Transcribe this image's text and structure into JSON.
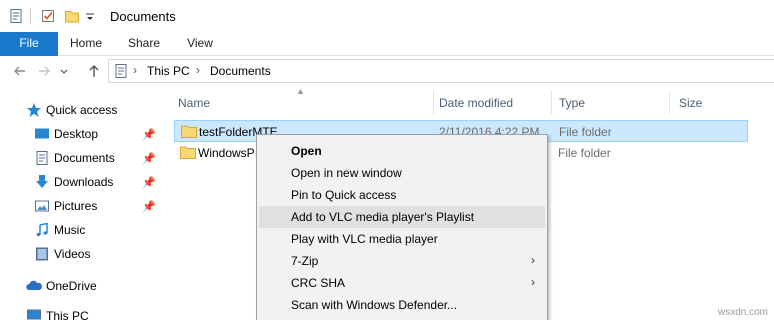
{
  "window": {
    "title": "Documents"
  },
  "ribbon": {
    "tabs": [
      "File",
      "Home",
      "Share",
      "View"
    ]
  },
  "address": {
    "crumbs": [
      "This PC",
      "Documents"
    ]
  },
  "nav": {
    "items": [
      {
        "label": "Quick access",
        "icon": "star-icon"
      },
      {
        "label": "Desktop",
        "icon": "desktop-icon",
        "pinned": true
      },
      {
        "label": "Documents",
        "icon": "documents-icon",
        "pinned": true
      },
      {
        "label": "Downloads",
        "icon": "download-icon",
        "pinned": true
      },
      {
        "label": "Pictures",
        "icon": "pictures-icon",
        "pinned": true
      },
      {
        "label": "Music",
        "icon": "music-icon"
      },
      {
        "label": "Videos",
        "icon": "videos-icon"
      },
      {
        "label": "OneDrive",
        "icon": "onedrive-icon"
      },
      {
        "label": "This PC",
        "icon": "pc-icon"
      }
    ]
  },
  "columns": {
    "name": "Name",
    "date": "Date modified",
    "type": "Type",
    "size": "Size"
  },
  "files": [
    {
      "name": "testFolderMTE",
      "date": "2/11/2016 4:22 PM",
      "type": "File folder",
      "selected": true
    },
    {
      "name": "WindowsP",
      "date": "",
      "type": "File folder",
      "selected": false
    }
  ],
  "context_menu": {
    "items": [
      {
        "label": "Open",
        "bold": true
      },
      {
        "label": "Open in new window"
      },
      {
        "label": "Pin to Quick access"
      },
      {
        "label": "Add to VLC media player's Playlist",
        "hover": true
      },
      {
        "label": "Play with VLC media player"
      },
      {
        "label": "7-Zip",
        "submenu": true
      },
      {
        "label": "CRC SHA",
        "submenu": true
      },
      {
        "label": "Scan with Windows Defender..."
      }
    ]
  },
  "watermark": "wsxdn.com",
  "colors": {
    "accent": "#1979ca",
    "selection": "#cce8ff",
    "selection_border": "#99d1ff",
    "folder": "#f8d775",
    "header_text": "#4c607a"
  }
}
